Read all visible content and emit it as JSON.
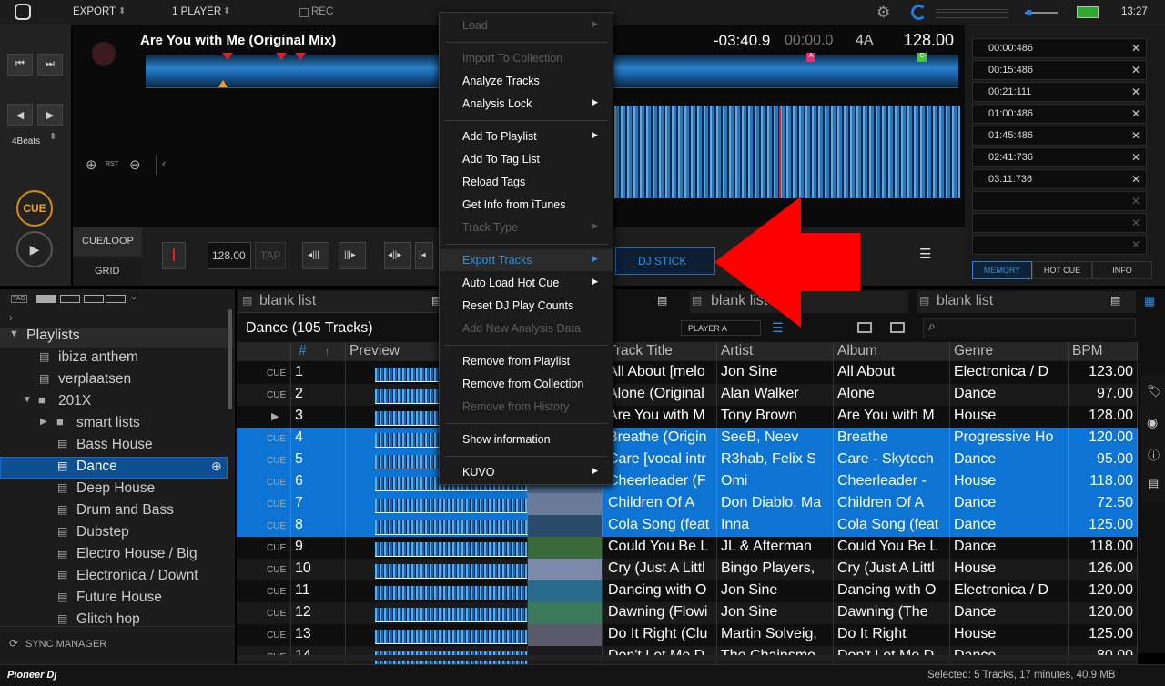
{
  "topbar": {
    "export_label": "EXPORT",
    "player_label": "1 PLAYER",
    "rec_label": "REC",
    "clock": "13:27"
  },
  "deck": {
    "title": "Are You with Me (Original Mix)",
    "remaining_time": "-03:40.9",
    "elapsed_time": "00:00.0",
    "key": "4A",
    "bpm": "128.00",
    "beats_label": "4Beats",
    "cue_label": "CUE",
    "rst_label": "RST",
    "cueloop_label": "CUE/LOOP",
    "grid_label": "GRID",
    "grid_bpm": "128.00",
    "tap_label": "TAP",
    "dj_stick_label": "DJ STICK"
  },
  "memory": {
    "times": [
      "00:00:486",
      "00:15:486",
      "00:21:111",
      "01:00:486",
      "01:45:486",
      "02:41:736",
      "03:11:736"
    ],
    "tabs": [
      "MEMORY",
      "HOT CUE",
      "INFO"
    ]
  },
  "sidebar": {
    "tag_label": "TAG",
    "playlists_label": "Playlists",
    "items": [
      "ibiza anthem",
      "verplaatsen",
      "201X",
      "smart lists",
      "Bass House",
      "Dance",
      "Deep House",
      "Drum and Bass",
      "Dubstep",
      "Electro House / Big",
      "Electronica / Downt",
      "Future House",
      "Glitch hop"
    ],
    "sync_label": "SYNC MANAGER"
  },
  "browser": {
    "tabs": [
      "blank list",
      "blank list",
      "blank list"
    ],
    "list_title": "Dance (105 Tracks)",
    "player_select": "PLAYER A",
    "columns": [
      "#",
      "Preview",
      "Track Title",
      "Artist",
      "Album",
      "Genre",
      "BPM"
    ],
    "rows": [
      {
        "cue": "CUE",
        "num": "1",
        "title": "All About [melo",
        "artist": "Jon Sine",
        "album": "All About",
        "genre": "Electronica / D",
        "bpm": "123.00"
      },
      {
        "cue": "CUE",
        "num": "2",
        "title": "Alone (Original",
        "artist": "Alan Walker",
        "album": "Alone",
        "genre": "Dance",
        "bpm": "97.00"
      },
      {
        "cue": "▶",
        "num": "3",
        "title": "Are You with M",
        "artist": "Tony Brown",
        "album": "Are You with M",
        "genre": "House",
        "bpm": "128.00"
      },
      {
        "cue": "CUE",
        "num": "4",
        "title": "Breathe (Origin",
        "artist": "SeeB, Neev",
        "album": "Breathe",
        "genre": "Progressive Ho",
        "bpm": "120.00"
      },
      {
        "cue": "CUE",
        "num": "5",
        "title": "Care [vocal intr",
        "artist": "R3hab, Felix S",
        "album": "Care - Skytech",
        "genre": "Dance",
        "bpm": "95.00"
      },
      {
        "cue": "CUE",
        "num": "6",
        "title": "Cheerleader (F",
        "artist": "Omi",
        "album": "Cheerleader -",
        "genre": "House",
        "bpm": "118.00"
      },
      {
        "cue": "CUE",
        "num": "7",
        "title": "Children Of A",
        "artist": "Don Diablo, Ma",
        "album": "Children Of A",
        "genre": "Dance",
        "bpm": "72.50"
      },
      {
        "cue": "CUE",
        "num": "8",
        "title": "Cola Song (feat",
        "artist": "Inna",
        "album": "Cola Song (feat",
        "genre": "Dance",
        "bpm": "125.00"
      },
      {
        "cue": "CUE",
        "num": "9",
        "title": "Could You Be L",
        "artist": "JL & Afterman",
        "album": "Could You Be L",
        "genre": "Dance",
        "bpm": "118.00"
      },
      {
        "cue": "CUE",
        "num": "10",
        "title": "Cry (Just A Littl",
        "artist": "Bingo Players,",
        "album": "Cry (Just A Littl",
        "genre": "House",
        "bpm": "126.00"
      },
      {
        "cue": "CUE",
        "num": "11",
        "title": "Dancing with O",
        "artist": "Jon Sine",
        "album": "Dancing with O",
        "genre": "Electronica / D",
        "bpm": "120.00"
      },
      {
        "cue": "CUE",
        "num": "12",
        "title": "Dawning (Flowi",
        "artist": "Jon Sine",
        "album": "Dawning (The",
        "genre": "Dance",
        "bpm": "120.00"
      },
      {
        "cue": "CUE",
        "num": "13",
        "title": "Do It Right (Clu",
        "artist": "Martin Solveig,",
        "album": "Do It Right",
        "genre": "House",
        "bpm": "125.00"
      },
      {
        "cue": "CUE",
        "num": "14",
        "title": "Don't Let Me D",
        "artist": "The Chainsmo",
        "album": "Don't Let Me D",
        "genre": "Dance",
        "bpm": "80.00"
      }
    ]
  },
  "context_menu": {
    "items": [
      {
        "label": "Load",
        "disabled": true,
        "submenu": true
      },
      {
        "label": "Import To Collection",
        "disabled": true,
        "submenu": false
      },
      {
        "label": "Analyze Tracks",
        "disabled": false,
        "submenu": false
      },
      {
        "label": "Analysis Lock",
        "disabled": false,
        "submenu": true
      },
      {
        "label": "Add To Playlist",
        "disabled": false,
        "submenu": true
      },
      {
        "label": "Add To Tag List",
        "disabled": false,
        "submenu": false
      },
      {
        "label": "Reload Tags",
        "disabled": false,
        "submenu": false
      },
      {
        "label": "Get Info from iTunes",
        "disabled": false,
        "submenu": false
      },
      {
        "label": "Track Type",
        "disabled": true,
        "submenu": true
      },
      {
        "label": "Export Tracks",
        "disabled": false,
        "submenu": true
      },
      {
        "label": "Auto Load Hot Cue",
        "disabled": false,
        "submenu": true
      },
      {
        "label": "Reset DJ Play Counts",
        "disabled": false,
        "submenu": false
      },
      {
        "label": "Add New Analysis Data",
        "disabled": true,
        "submenu": false
      },
      {
        "label": "Remove from Playlist",
        "disabled": false,
        "submenu": false
      },
      {
        "label": "Remove from Collection",
        "disabled": false,
        "submenu": false
      },
      {
        "label": "Remove from History",
        "disabled": true,
        "submenu": false
      },
      {
        "label": "Show information",
        "disabled": false,
        "submenu": false
      },
      {
        "label": "KUVO",
        "disabled": false,
        "submenu": true
      }
    ]
  },
  "statusbar": {
    "brand": "Pioneer Dj",
    "selected_info": "Selected: 5 Tracks, 17 minutes, 40.9 MB"
  },
  "colors": {
    "accent": "#0d74d3",
    "cue_orange": "#f0a020",
    "arrow_red": "#ff0000",
    "waveform_blue": "#2a8ad8"
  }
}
